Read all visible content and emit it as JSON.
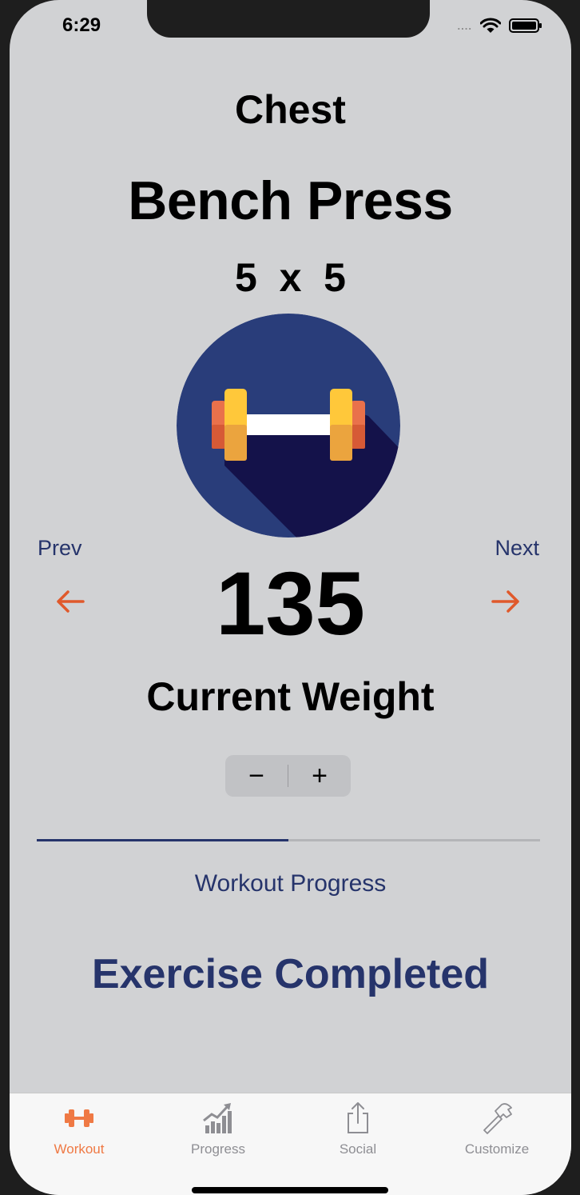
{
  "status_bar": {
    "time": "6:29",
    "signal": "....",
    "icons": [
      "wifi-icon",
      "battery-icon"
    ]
  },
  "workout": {
    "category": "Chest",
    "exercise": "Bench Press",
    "sets_reps": "5  x  5",
    "image_icon": "dumbbell-icon"
  },
  "navigation": {
    "prev_label": "Prev",
    "next_label": "Next"
  },
  "weight": {
    "value": "135",
    "label": "Current Weight"
  },
  "stepper": {
    "minus": "−",
    "plus": "+"
  },
  "progress": {
    "fraction": 0.5,
    "label": "Workout Progress"
  },
  "status": {
    "message": "Exercise Completed"
  },
  "tab_bar": {
    "items": [
      {
        "label": "Workout",
        "icon": "dumbbell-icon",
        "active": true
      },
      {
        "label": "Progress",
        "icon": "chart-icon",
        "active": false
      },
      {
        "label": "Social",
        "icon": "share-icon",
        "active": false
      },
      {
        "label": "Customize",
        "icon": "hammer-icon",
        "active": false
      }
    ]
  },
  "colors": {
    "accent": "#26346b",
    "arrow": "#e0592b",
    "active_tab": "#ef7944",
    "background": "#d1d2d4"
  }
}
